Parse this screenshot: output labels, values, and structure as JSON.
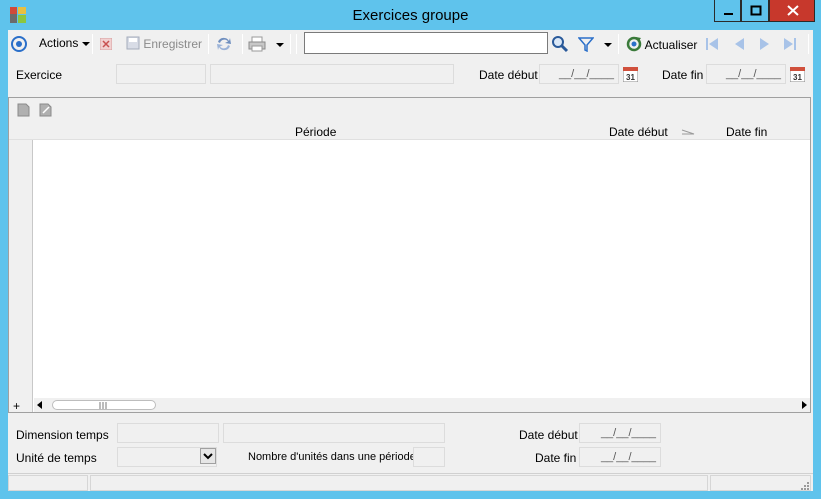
{
  "window": {
    "title": "Exercices groupe"
  },
  "toolbar": {
    "actions_label": "Actions",
    "save_label": "Enregistrer",
    "search_value": "",
    "refresh_label": "Actualiser"
  },
  "header_form": {
    "exercice_label": "Exercice",
    "exercice_code": "",
    "exercice_name": "",
    "date_debut_label": "Date début",
    "date_debut_value": "__/__/____",
    "date_fin_label": "Date fin",
    "date_fin_value": "__/__/____",
    "cal_day": "31"
  },
  "grid": {
    "columns": [
      "Période",
      "Date début",
      "Date fin"
    ],
    "rows": [],
    "add_symbol": "+"
  },
  "bottom_form": {
    "dimension_label": "Dimension temps",
    "dimension_code": "",
    "dimension_name": "",
    "unit_label": "Unité de temps",
    "unit_value": "",
    "units_count_label": "Nombre d'unités dans une période",
    "units_count_value": "",
    "date_debut_label": "Date début",
    "date_debut_value": "__/__/____",
    "date_fin_label": "Date fin",
    "date_fin_value": "__/__/____"
  },
  "colors": {
    "frame": "#5fc3ec",
    "close": "#c7382c"
  }
}
